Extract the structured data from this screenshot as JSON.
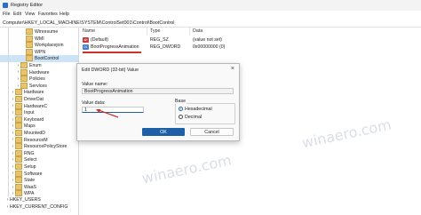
{
  "window": {
    "title": "Registry Editor"
  },
  "menu": [
    "File",
    "Edit",
    "View",
    "Favorites",
    "Help"
  ],
  "address": "Computer\\HKEY_LOCAL_MACHINE\\SYSTEM\\ControlSet001\\Control\\BootControl",
  "tree": {
    "items": [
      {
        "label": "Winresume",
        "indent": 2
      },
      {
        "label": "WMI",
        "indent": 2
      },
      {
        "label": "Workplacejoin",
        "indent": 2
      },
      {
        "label": "WPN",
        "indent": 2
      },
      {
        "label": "BootControl",
        "indent": 2,
        "selected": true
      },
      {
        "label": "Enum",
        "indent": 1
      },
      {
        "label": "Hardware",
        "indent": 1
      },
      {
        "label": "Policies",
        "indent": 1
      },
      {
        "label": "Services",
        "indent": 1
      },
      {
        "label": "Hardware",
        "indent": 0
      },
      {
        "label": "DriverDat",
        "indent": 0
      },
      {
        "label": "HardwareC",
        "indent": 0
      },
      {
        "label": "Input",
        "indent": 0
      },
      {
        "label": "Keyboard",
        "indent": 0
      },
      {
        "label": "Maps",
        "indent": 0
      },
      {
        "label": "MountedD",
        "indent": 0
      },
      {
        "label": "ResourceM",
        "indent": 0
      },
      {
        "label": "ResourcePolicyStore",
        "indent": 0
      },
      {
        "label": "RNG",
        "indent": 0
      },
      {
        "label": "Select",
        "indent": 0
      },
      {
        "label": "Setup",
        "indent": 0
      },
      {
        "label": "Software",
        "indent": 0
      },
      {
        "label": "State",
        "indent": 0
      },
      {
        "label": "WaaS",
        "indent": 0
      },
      {
        "label": "WPA",
        "indent": 0
      },
      {
        "label": "HKEY_USERS",
        "indent": -1
      },
      {
        "label": "HKEY_CURRENT_CONFIG",
        "indent": -1
      }
    ]
  },
  "values_table": {
    "headers": [
      "Name",
      "Type",
      "Data"
    ],
    "rows": [
      {
        "icon": "ab",
        "name": "(Default)",
        "type": "REG_SZ",
        "data": "(value not set)"
      },
      {
        "icon": "bin",
        "name": "BootProgressAnimation",
        "type": "REG_DWORD",
        "data": "0x00000000 (0)"
      }
    ]
  },
  "dialog": {
    "title": "Edit DWORD (32-bit) Value",
    "close": "×",
    "value_name_label": "Value name:",
    "value_name": "BootProgressAnimation",
    "value_data_label": "Value data:",
    "value_data": "1",
    "base_label": "Base",
    "base_options": [
      "Hexadecimal",
      "Decimal"
    ],
    "base_selected": "Hexadecimal",
    "ok": "OK",
    "cancel": "Cancel"
  },
  "watermark": "winaero.com",
  "colors": {
    "accent": "#1f5fa8",
    "highlight": "#d0302a",
    "selection": "#cde3f7"
  }
}
